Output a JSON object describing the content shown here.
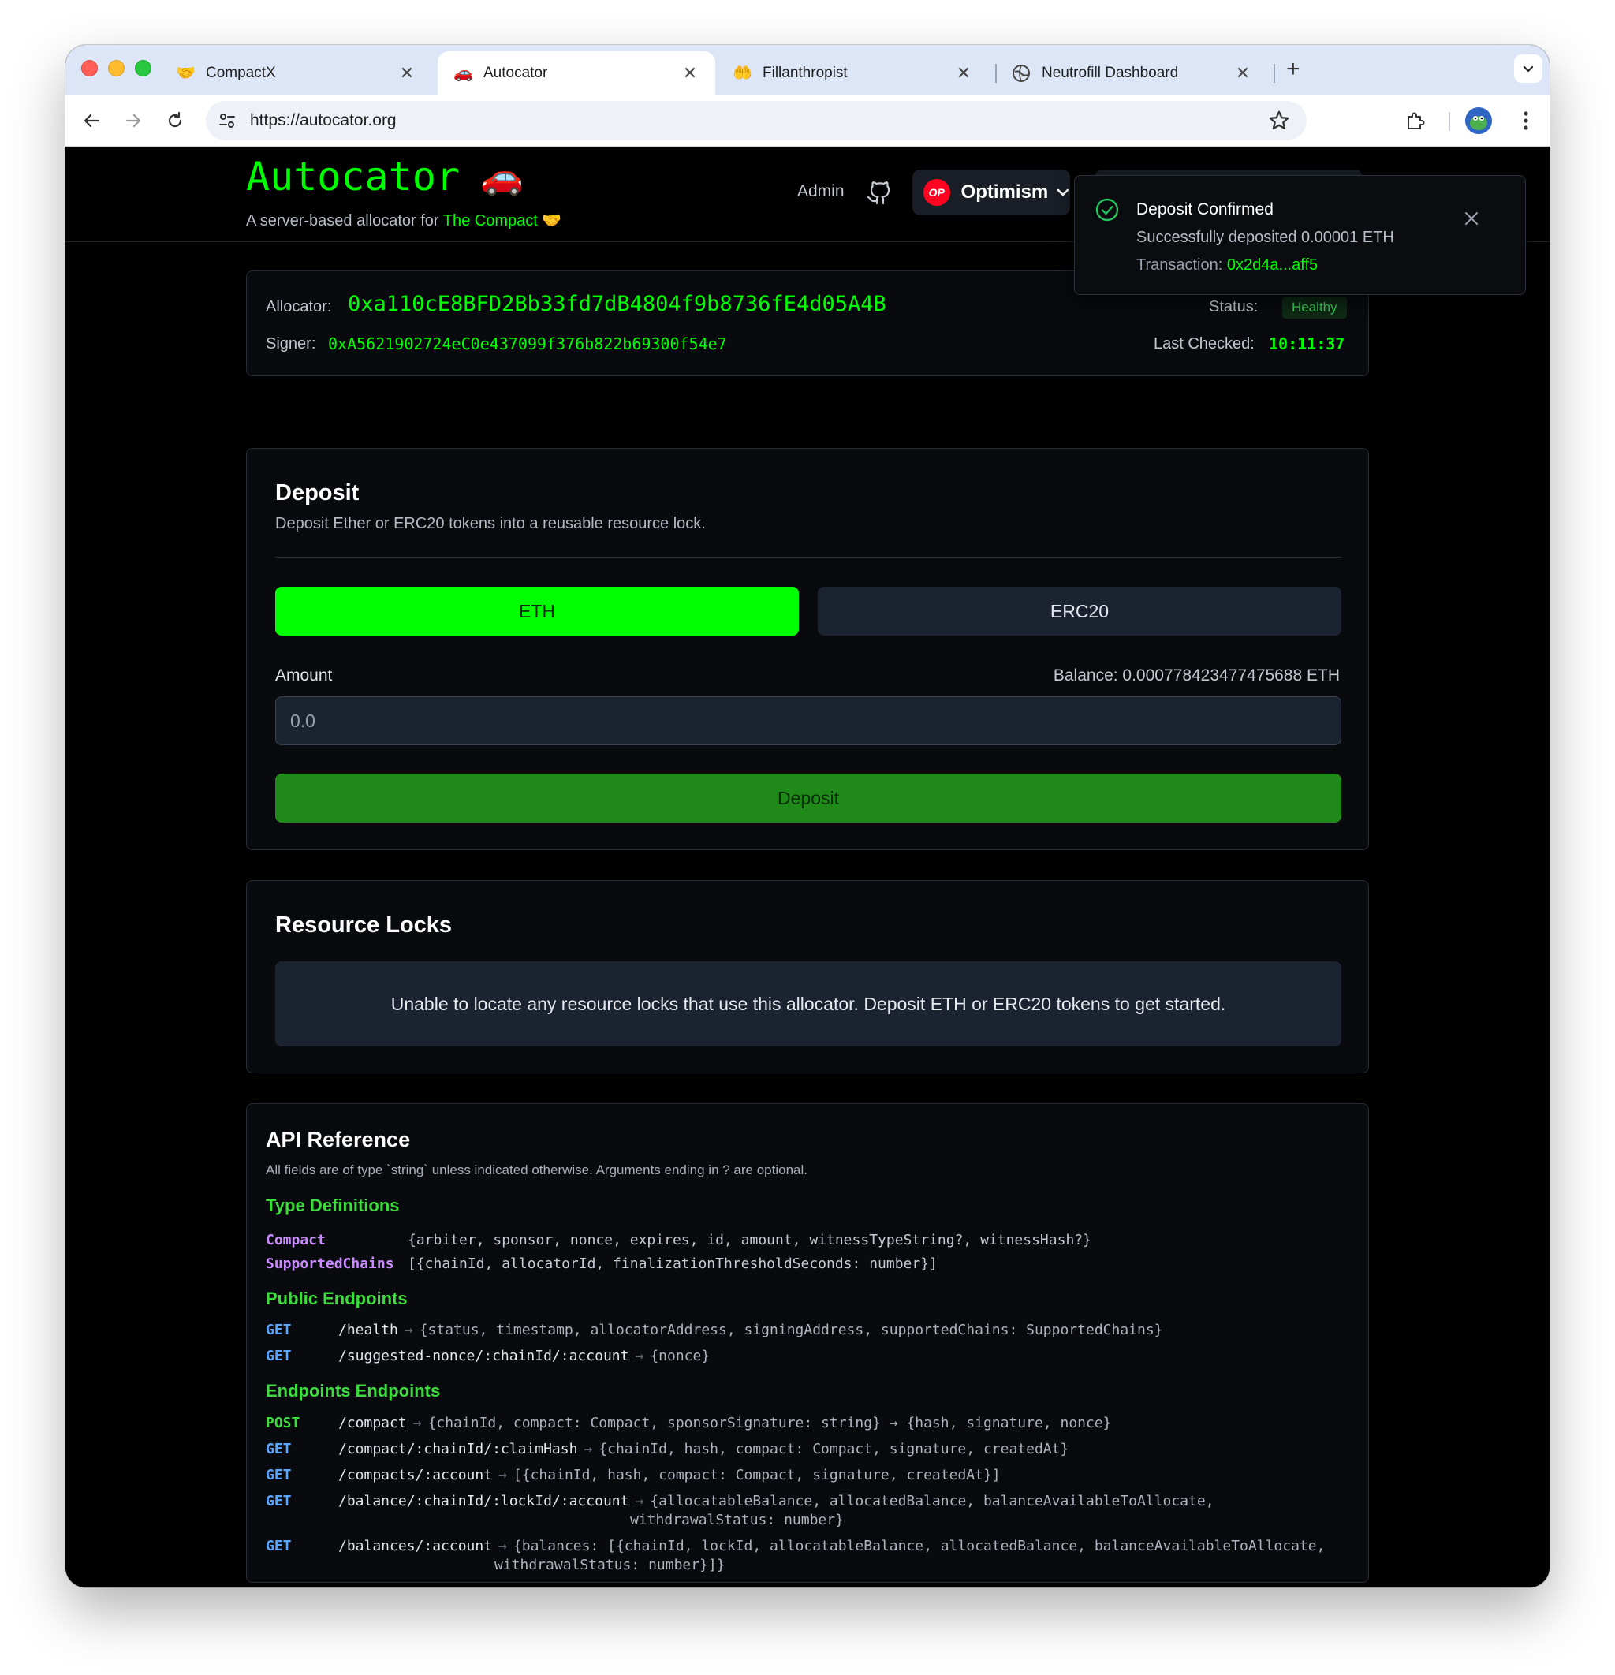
{
  "browser": {
    "tabs": [
      {
        "label": "CompactX",
        "favicon": "🤝"
      },
      {
        "label": "Autocator",
        "favicon": "🚗"
      },
      {
        "label": "Fillanthropist",
        "favicon": "🤲"
      },
      {
        "label": "Neutrofill Dashboard",
        "favicon": "globe-icon"
      }
    ],
    "url": "https://autocator.org"
  },
  "header": {
    "brand": "Autocator",
    "brand_emoji": "🚗",
    "tagline_prefix": "A server-based allocator for ",
    "tagline_link": "The Compact",
    "tagline_emoji": "🤝",
    "admin_label": "Admin",
    "network_badge": "OP",
    "network_label": "Optimism"
  },
  "allocator": {
    "allocator_label": "Allocator:",
    "allocator_address": "0xa110cE8BFD2Bb33fd7dB4804f9b8736fE4d05A4B",
    "signer_label": "Signer:",
    "signer_address": "0xA5621902724eC0e437099f376b822b69300f54e7",
    "status_label": "Status:",
    "status_value": "Healthy",
    "last_checked_label": "Last Checked:",
    "last_checked_value": "10:11:37"
  },
  "deposit": {
    "title": "Deposit",
    "subtitle": "Deposit Ether or ERC20 tokens into a reusable resource lock.",
    "eth_label": "ETH",
    "erc20_label": "ERC20",
    "amount_label": "Amount",
    "balance_label": "Balance: 0.000778423477475688 ETH",
    "amount_placeholder": "0.0",
    "deposit_button": "Deposit"
  },
  "resource_locks": {
    "title": "Resource Locks",
    "empty_message": "Unable to locate any resource locks that use this allocator. Deposit ETH or ERC20 tokens to get started."
  },
  "api": {
    "title": "API Reference",
    "subtitle": "All fields are of type `string` unless indicated otherwise. Arguments ending in ? are optional.",
    "type_section": "Type Definitions",
    "types": [
      {
        "name": "Compact",
        "def": "{arbiter, sponsor, nonce, expires, id, amount, witnessTypeString?, witnessHash?}"
      },
      {
        "name": "SupportedChains",
        "def": "[{chainId, allocatorId, finalizationThresholdSeconds: number}]"
      }
    ],
    "public_section": "Public Endpoints",
    "public_endpoints": [
      {
        "method": "GET",
        "path": "/health",
        "ret": "{status, timestamp, allocatorAddress, signingAddress, supportedChains: SupportedChains}"
      },
      {
        "method": "GET",
        "path": "/suggested-nonce/:chainId/:account",
        "ret": "{nonce}"
      }
    ],
    "endpoints_section": "Endpoints Endpoints",
    "endpoints": [
      {
        "method": "POST",
        "path": "/compact",
        "ret": "{chainId, compact: Compact, sponsorSignature: string} → {hash, signature, nonce}",
        "ret2": ""
      },
      {
        "method": "GET",
        "path": "/compact/:chainId/:claimHash",
        "ret": "{chainId, hash, compact: Compact, signature, createdAt}",
        "ret2": ""
      },
      {
        "method": "GET",
        "path": "/compacts/:account",
        "ret": "[{chainId, hash, compact: Compact, signature, createdAt}]",
        "ret2": ""
      },
      {
        "method": "GET",
        "path": "/balance/:chainId/:lockId/:account",
        "ret": "{allocatableBalance, allocatedBalance, balanceAvailableToAllocate,",
        "ret2": "withdrawalStatus: number}"
      },
      {
        "method": "GET",
        "path": "/balances/:account",
        "ret": "{balances: [{chainId, lockId, allocatableBalance, allocatedBalance, balanceAvailableToAllocate,",
        "ret2": "withdrawalStatus: number}]}"
      }
    ],
    "arrow": "→"
  },
  "toast": {
    "title": "Deposit Confirmed",
    "message": "Successfully deposited 0.00001 ETH",
    "tx_label": "Transaction: ",
    "tx_value": "0x2d4a...aff5"
  },
  "colors": {
    "accent": "#00ff00",
    "background": "#000000",
    "card": "#1c2330",
    "op_red": "#ff0420"
  }
}
